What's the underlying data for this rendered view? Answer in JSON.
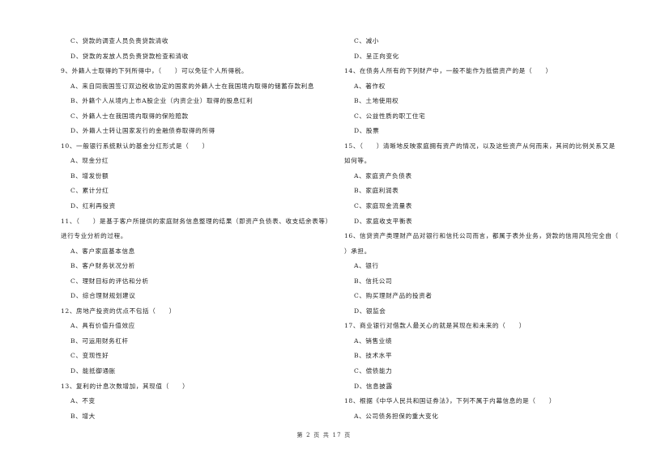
{
  "left_column": [
    {
      "type": "opt",
      "text": "C、贷款的调查人员负责贷款清收"
    },
    {
      "type": "opt",
      "text": "D、贷款的发放人员负责贷款检查和清收"
    },
    {
      "type": "q",
      "text": "9、外籍人士取得的下列所得中，（　　）可以免征个人所得税。"
    },
    {
      "type": "opt",
      "text": "A、来自同我国签订双边税收协定的国家的外籍人士在我国境内取得的储蓄存款利息"
    },
    {
      "type": "opt",
      "text": "B、外籍个人从境内上市A股企业（内资企业）取得的股息红利"
    },
    {
      "type": "opt",
      "text": "C、外籍人士在我国境内取得的保险赔款"
    },
    {
      "type": "opt",
      "text": "D、外籍人士转让国家发行的金融债券取得的所得"
    },
    {
      "type": "q",
      "text": "10、一般银行系统默认的基金分红形式是（　　）"
    },
    {
      "type": "opt",
      "text": "A、现金分红"
    },
    {
      "type": "opt",
      "text": "B、增发份额"
    },
    {
      "type": "opt",
      "text": "C、累计分红"
    },
    {
      "type": "opt",
      "text": "D、红利再投资"
    },
    {
      "type": "q",
      "text": "11、（　　）是基于客户所提供的家庭财务信息整理的结果（即资产负债表、收支结余表等）"
    },
    {
      "type": "q",
      "text": "进行专业分析的过程。"
    },
    {
      "type": "opt",
      "text": "A、客户家庭基本信息"
    },
    {
      "type": "opt",
      "text": "B、客户财务状况分析"
    },
    {
      "type": "opt",
      "text": "C、理财目标的评估和分析"
    },
    {
      "type": "opt",
      "text": "D、综合理财规划建议"
    },
    {
      "type": "q",
      "text": "12、房地产投资的优点不包括（　　）"
    },
    {
      "type": "opt",
      "text": "A、具有价值升值效应"
    },
    {
      "type": "opt",
      "text": "B、可运用财务杠杆"
    },
    {
      "type": "opt",
      "text": "C、变现性好"
    },
    {
      "type": "opt",
      "text": "D、能抵御通胀"
    },
    {
      "type": "q",
      "text": "13、复利的计息次数增加，其现值（　　）"
    },
    {
      "type": "opt",
      "text": "A、不变"
    },
    {
      "type": "opt",
      "text": "B、增大"
    }
  ],
  "right_column": [
    {
      "type": "opt",
      "text": "C、减小"
    },
    {
      "type": "opt",
      "text": "D、呈正向变化"
    },
    {
      "type": "q",
      "text": "14、在债务人所有的下列财产中，一般不能作为抵偿资产的是（　　）"
    },
    {
      "type": "opt",
      "text": "A、著作权"
    },
    {
      "type": "opt",
      "text": "B、土地使用权"
    },
    {
      "type": "opt",
      "text": "C、公益性质的职工住宅"
    },
    {
      "type": "opt",
      "text": "D、股票"
    },
    {
      "type": "q",
      "text": "15、（　　）清晰地反映家庭拥有资产的情况，以及这些资产从何而来，其间的比例关系又是"
    },
    {
      "type": "q",
      "text": "如何等。"
    },
    {
      "type": "opt",
      "text": "A、家庭资产负债表"
    },
    {
      "type": "opt",
      "text": "B、家庭利润表"
    },
    {
      "type": "opt",
      "text": "C、家庭现金流量表"
    },
    {
      "type": "opt",
      "text": "D、家庭收支平衡表"
    },
    {
      "type": "q",
      "text": "16、信贷资产类理财产品对银行和信托公司而言，都属于表外业务，贷款的信用风险完全由（"
    },
    {
      "type": "q",
      "text": "）承担。"
    },
    {
      "type": "opt",
      "text": "A、银行"
    },
    {
      "type": "opt",
      "text": "B、信托公司"
    },
    {
      "type": "opt",
      "text": "C、购买理财产品的投资者"
    },
    {
      "type": "opt",
      "text": "D、银监会"
    },
    {
      "type": "q",
      "text": "17、商业银行对借款人最关心的就是其现在和未来的（　　）"
    },
    {
      "type": "opt",
      "text": "A、销售业绩"
    },
    {
      "type": "opt",
      "text": "B、技术水平"
    },
    {
      "type": "opt",
      "text": "C、偿债能力"
    },
    {
      "type": "opt",
      "text": "D、信息披露"
    },
    {
      "type": "q",
      "text": "18、根据《中华人民共和国证券法》，下列不属于内幕信息的是（　　）"
    },
    {
      "type": "opt",
      "text": "A、公司债务担保的重大变化"
    }
  ],
  "footer": {
    "page_label": "第 2 页 共 17 页"
  }
}
